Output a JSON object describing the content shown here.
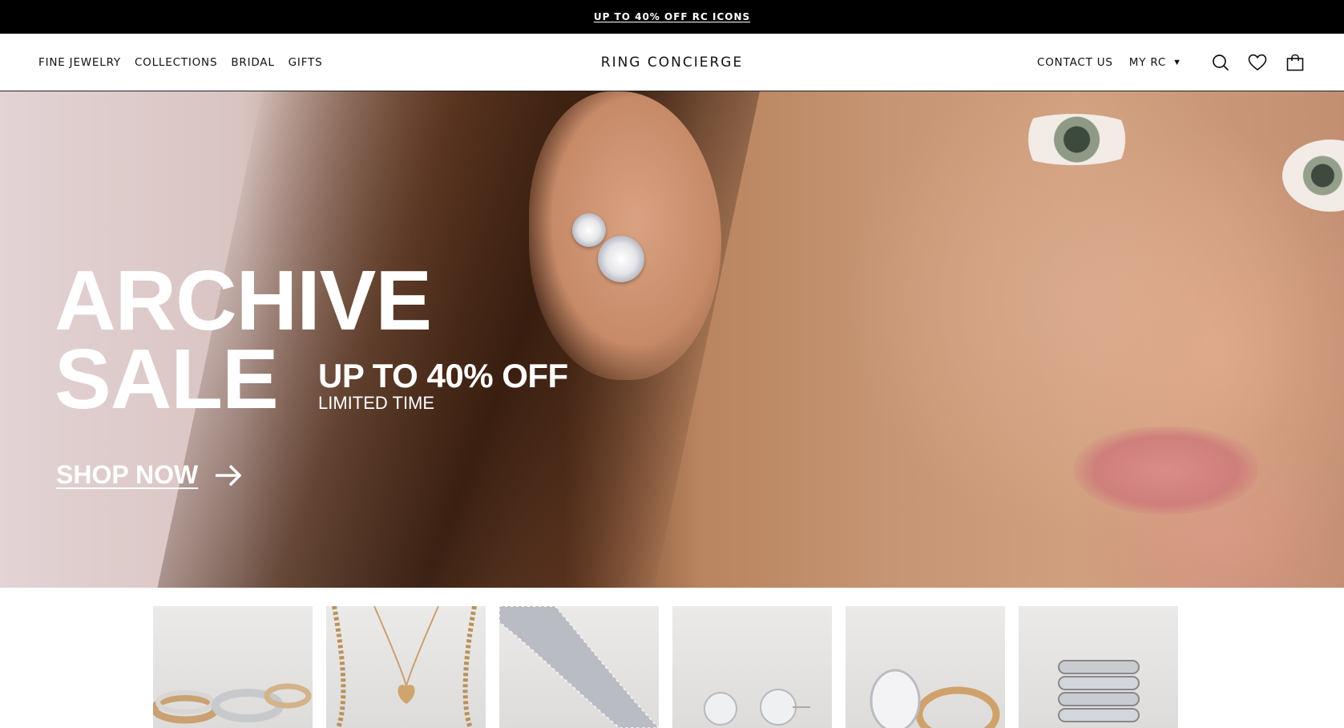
{
  "promo": {
    "text": "UP TO 40% OFF RC ICONS"
  },
  "header": {
    "nav": [
      "FINE JEWELRY",
      "COLLECTIONS",
      "BRIDAL",
      "GIFTS"
    ],
    "logo": "RING CONCIERGE",
    "contact": "CONTACT US",
    "account": "MY RC"
  },
  "hero": {
    "title_line1": "ARCHIVE",
    "title_line2": "SALE",
    "offer": "UP TO 40% OFF",
    "offer_sub": "LIMITED TIME",
    "cta": "SHOP NOW"
  },
  "tiles": [
    {
      "name": "tile-rings"
    },
    {
      "name": "tile-necklaces"
    },
    {
      "name": "tile-bracelets"
    },
    {
      "name": "tile-earrings"
    },
    {
      "name": "tile-engagement"
    },
    {
      "name": "tile-bands"
    }
  ],
  "icons": [
    "search-icon",
    "heart-icon",
    "bag-icon",
    "arrow-right-icon",
    "caret-down-icon"
  ],
  "colors": {
    "promo_bg": "#000000",
    "hero_text": "#ffffff",
    "text": "#111111"
  }
}
